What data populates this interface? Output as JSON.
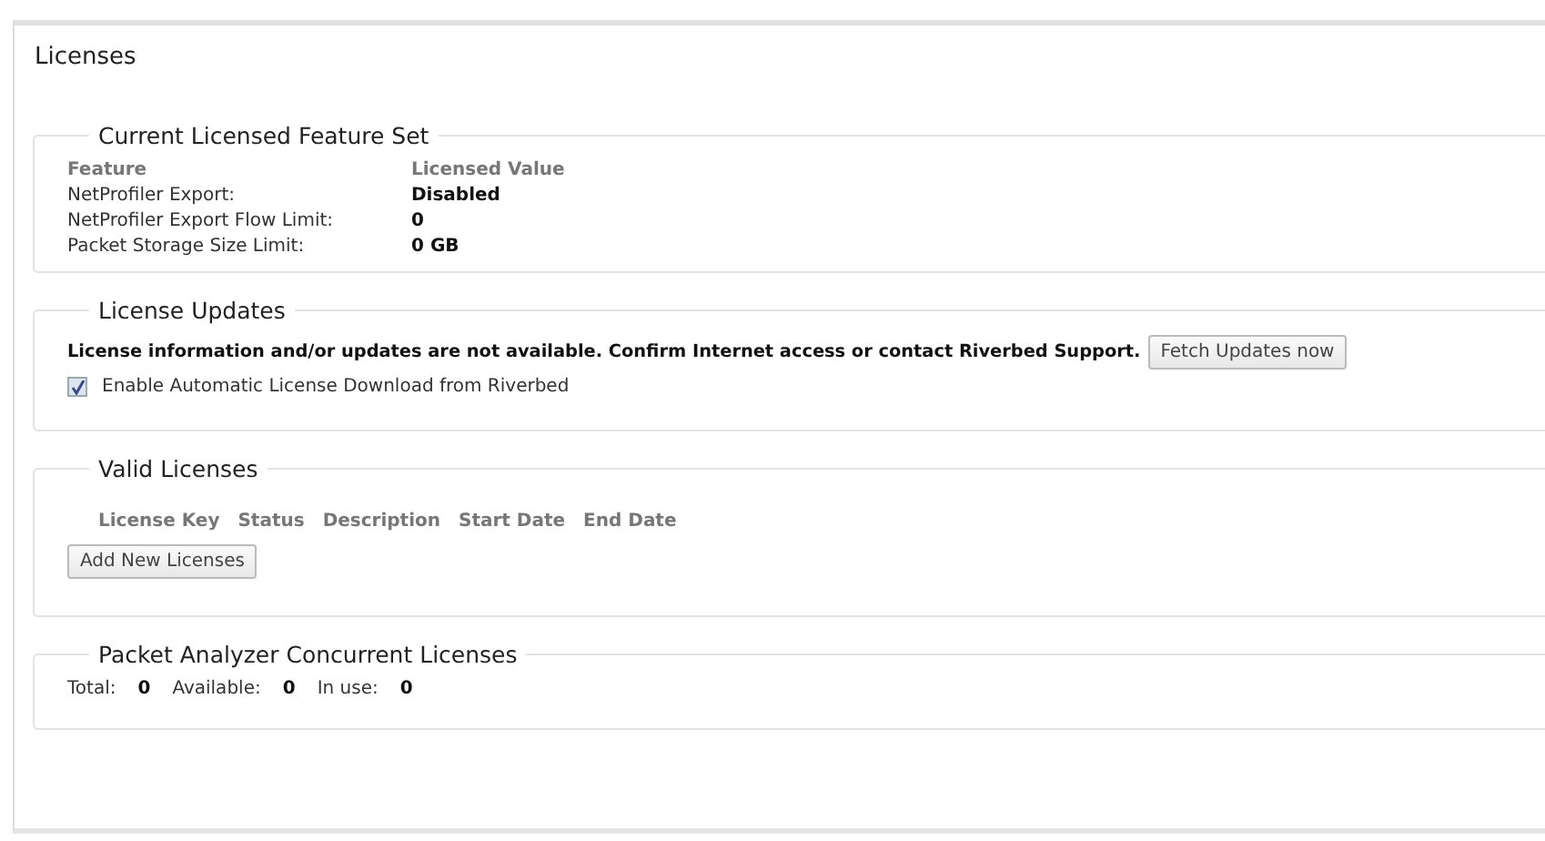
{
  "page": {
    "title": "Licenses"
  },
  "feature_set": {
    "legend": "Current Licensed Feature Set",
    "columns": [
      "Feature",
      "Licensed Value"
    ],
    "rows": [
      {
        "feature": "NetProfiler Export:",
        "value": "Disabled"
      },
      {
        "feature": "NetProfiler Export Flow Limit:",
        "value": "0"
      },
      {
        "feature": "Packet Storage Size Limit:",
        "value": "0 GB"
      }
    ]
  },
  "license_updates": {
    "legend": "License Updates",
    "message": "License information and/or updates are not available. Confirm Internet access or contact Riverbed Support.",
    "button": "Fetch Updates now",
    "checkbox": {
      "label": "Enable Automatic License Download from Riverbed",
      "checked": true
    }
  },
  "valid_licenses": {
    "legend": "Valid Licenses",
    "columns": [
      "License Key",
      "Status",
      "Description",
      "Start Date",
      "End Date"
    ],
    "button": "Add New Licenses"
  },
  "concurrent": {
    "legend": "Packet Analyzer Concurrent Licenses",
    "stats": [
      {
        "label": "Total:",
        "value": "0"
      },
      {
        "label": "Available:",
        "value": "0"
      },
      {
        "label": "In use:",
        "value": "0"
      }
    ]
  }
}
